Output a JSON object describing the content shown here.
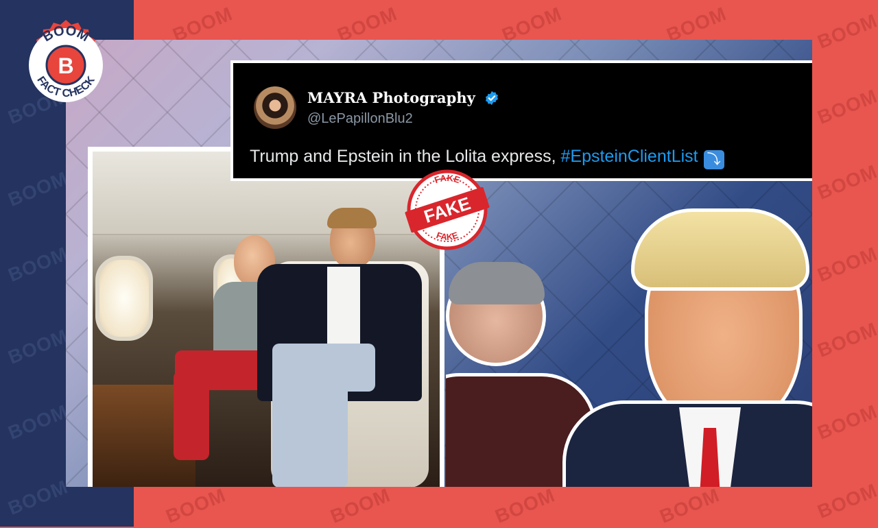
{
  "brand": {
    "logo_top_text": "BOOM",
    "logo_letter": "B",
    "logo_bottom_text": "FACT CHECK",
    "watermark_text": "BOOM"
  },
  "colors": {
    "background_red": "#e8564f",
    "background_navy": "#24335f",
    "tweet_bg": "#000000",
    "hashtag_blue": "#1d9bf0",
    "stamp_red": "#d9262c"
  },
  "tweet": {
    "display_name": "MAYRA Photography",
    "handle": "@LePapillonBlu2",
    "text_before_hashtag": "Trump and Epstein in the Lolita express, ",
    "hashtag": "#EpsteinClientList",
    "emoji_icon": "right-arrow-curving-down-icon",
    "verified_icon": "verified-badge-icon"
  },
  "stamp": {
    "main_text": "FAKE",
    "top_arc_text": "FAKE",
    "bottom_arc_text": "FAKE"
  }
}
